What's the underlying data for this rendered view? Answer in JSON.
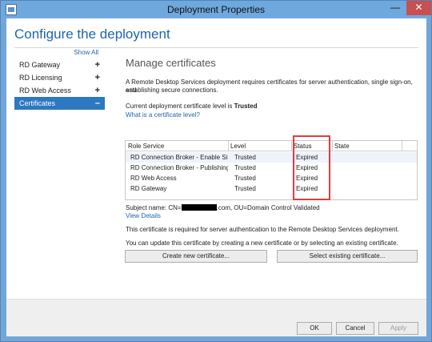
{
  "window": {
    "title": "Deployment Properties",
    "min_label": "—",
    "close_label": "✕"
  },
  "header": {
    "title": "Configure the deployment"
  },
  "nav": {
    "show_all": "Show All",
    "items": [
      {
        "label": "RD Gateway",
        "indicator": "+"
      },
      {
        "label": "RD Licensing",
        "indicator": "+"
      },
      {
        "label": "RD Web Access",
        "indicator": "+"
      },
      {
        "label": "Certificates",
        "indicator": "–"
      }
    ]
  },
  "main": {
    "heading": "Manage certificates",
    "description_line1": "A Remote Desktop Services deployment requires certificates for server authentication, single sign-on, and",
    "description_line2": "establishing secure connections.",
    "current_level_prefix": "Current deployment certificate level is ",
    "current_level_value": "Trusted",
    "certificate_level_link": "What is a certificate level?",
    "table": {
      "columns": [
        "Role Service",
        "Level",
        "Status",
        "State"
      ],
      "rows": [
        {
          "role": "RD Connection Broker - Enable Sing",
          "level": "Trusted",
          "status": "Expired",
          "state": ""
        },
        {
          "role": "RD Connection Broker - Publishing",
          "level": "Trusted",
          "status": "Expired",
          "state": ""
        },
        {
          "role": "RD Web Access",
          "level": "Trusted",
          "status": "Expired",
          "state": ""
        },
        {
          "role": "RD Gateway",
          "level": "Trusted",
          "status": "Expired",
          "state": ""
        }
      ]
    },
    "subject_prefix": "Subject name: CN=",
    "subject_suffix": ".com, OU=Domain Control Validated",
    "view_details_link": "View Details",
    "required_note": "This certificate is required for server authentication to the Remote Desktop Services deployment.",
    "update_note": "You can update this certificate by creating a new certificate or by selecting an existing certificate.",
    "create_button": "Create new certificate...",
    "select_button": "Select existing certificate..."
  },
  "footer": {
    "ok": "OK",
    "cancel": "Cancel",
    "apply": "Apply"
  },
  "colors": {
    "title_blue": "#1f64a8",
    "selected_nav": "#2d78c0",
    "highlight_red": "#e53b3b",
    "link": "#1e64b4"
  }
}
